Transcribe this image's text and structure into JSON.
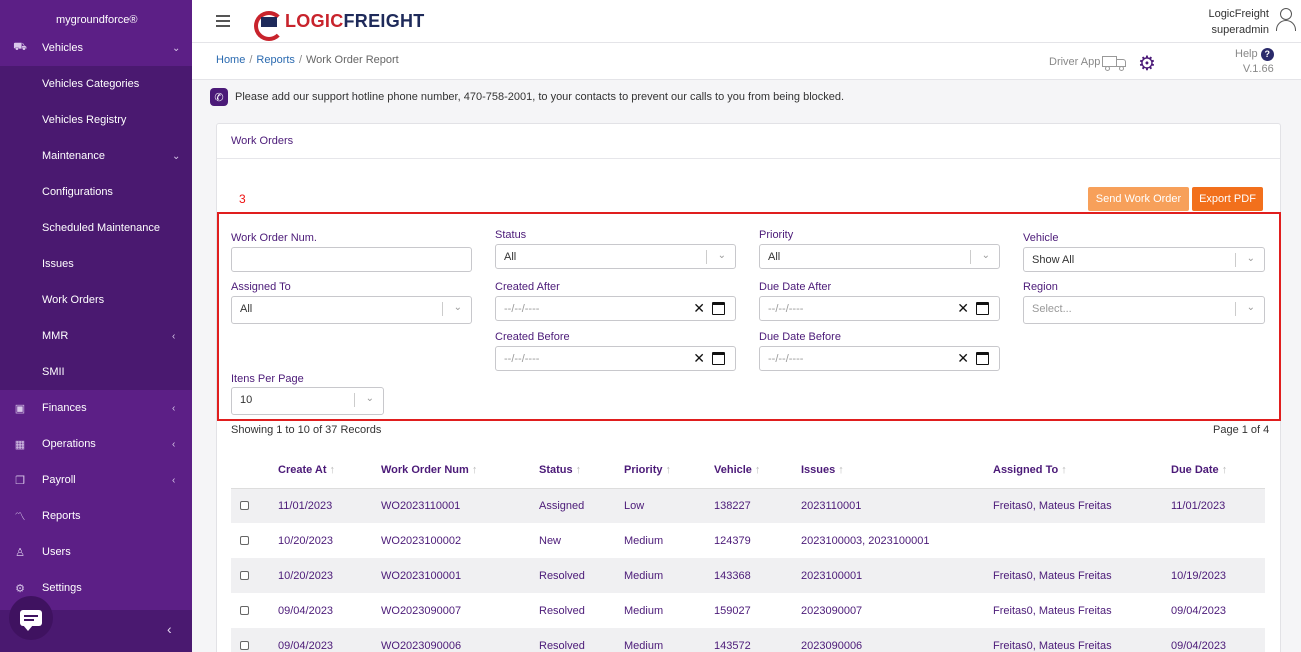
{
  "sidebar": {
    "brand": "mygroundforce®",
    "items": [
      {
        "label": "Vehicles",
        "icon": "truck-icon",
        "glyph": "⛟",
        "chev": "⌄"
      },
      {
        "label": "Vehicles Categories"
      },
      {
        "label": "Vehicles Registry"
      },
      {
        "label": "Maintenance",
        "chev": "⌄"
      },
      {
        "label": "Configurations"
      },
      {
        "label": "Scheduled Maintenance"
      },
      {
        "label": "Issues"
      },
      {
        "label": "Work Orders"
      },
      {
        "label": "MMR",
        "chev": "‹"
      },
      {
        "label": "SMII"
      },
      {
        "label": "Finances",
        "icon": "finances-icon",
        "glyph": "▣",
        "chev": "‹"
      },
      {
        "label": "Operations",
        "icon": "calendar-icon",
        "glyph": "▦",
        "chev": "‹"
      },
      {
        "label": "Payroll",
        "icon": "payroll-icon",
        "glyph": "❐",
        "chev": "‹"
      },
      {
        "label": "Reports",
        "icon": "chart-line-icon",
        "glyph": "〽"
      },
      {
        "label": "Users",
        "icon": "users-icon",
        "glyph": "♙"
      },
      {
        "label": "Settings",
        "icon": "settings-icon",
        "glyph": "⚙"
      }
    ],
    "collapse": "‹"
  },
  "topbar": {
    "logo_part1": "LOGIC",
    "logo_part2": "FREIGHT",
    "user_name": "LogicFreight",
    "user_role": "superadmin"
  },
  "breadcrumb": {
    "home": "Home",
    "reports": "Reports",
    "current": "Work Order Report",
    "sep": "/"
  },
  "header_tools": {
    "driver_app": "Driver App",
    "help": "Help",
    "help_q": "?",
    "version": "V.1.66"
  },
  "notice": {
    "text": "Please add our support hotline phone number, 470-758-2001, to your contacts to prevent our calls to you from being blocked."
  },
  "card": {
    "title": "Work Orders",
    "annotation": "3",
    "send_button": "Send Work Order",
    "export_button": "Export PDF"
  },
  "filters": {
    "work_order_num": {
      "label": "Work Order Num.",
      "value": ""
    },
    "status": {
      "label": "Status",
      "value": "All"
    },
    "priority": {
      "label": "Priority",
      "value": "All"
    },
    "vehicle": {
      "label": "Vehicle",
      "value": "Show All"
    },
    "assigned_to": {
      "label": "Assigned To",
      "value": "All"
    },
    "created_after": {
      "label": "Created After",
      "placeholder": "--/--/----"
    },
    "due_date_after": {
      "label": "Due Date After",
      "placeholder": "--/--/----"
    },
    "region": {
      "label": "Region",
      "placeholder": "Select..."
    },
    "created_before": {
      "label": "Created Before",
      "placeholder": "--/--/----"
    },
    "due_date_before": {
      "label": "Due Date Before",
      "placeholder": "--/--/----"
    },
    "items_per_page": {
      "label": "Itens Per Page",
      "value": "10"
    }
  },
  "table": {
    "records_text": "Showing 1 to 10 of 37 Records",
    "page_text": "Page 1 of 4",
    "columns": [
      "Create At",
      "Work Order Num",
      "Status",
      "Priority",
      "Vehicle",
      "Issues",
      "Assigned To",
      "Due Date"
    ],
    "rows": [
      {
        "create_at": "11/01/2023",
        "wo": "WO2023110001",
        "status": "Assigned",
        "priority": "Low",
        "vehicle": "138227",
        "issues": "2023110001",
        "assigned": "Freitas0, Mateus Freitas",
        "due": "11/01/2023"
      },
      {
        "create_at": "10/20/2023",
        "wo": "WO2023100002",
        "status": "New",
        "priority": "Medium",
        "vehicle": "124379",
        "issues": "2023100003, 2023100001",
        "assigned": "",
        "due": ""
      },
      {
        "create_at": "10/20/2023",
        "wo": "WO2023100001",
        "status": "Resolved",
        "priority": "Medium",
        "vehicle": "143368",
        "issues": "2023100001",
        "assigned": "Freitas0, Mateus Freitas",
        "due": "10/19/2023"
      },
      {
        "create_at": "09/04/2023",
        "wo": "WO2023090007",
        "status": "Resolved",
        "priority": "Medium",
        "vehicle": "159027",
        "issues": "2023090007",
        "assigned": "Freitas0, Mateus Freitas",
        "due": "09/04/2023"
      },
      {
        "create_at": "09/04/2023",
        "wo": "WO2023090006",
        "status": "Resolved",
        "priority": "Medium",
        "vehicle": "143572",
        "issues": "2023090006",
        "assigned": "Freitas0, Mateus Freitas",
        "due": "09/04/2023"
      }
    ]
  },
  "colors": {
    "sidebar": "#5c1f86",
    "sidebar_sub": "#4a1970",
    "accent": "#4b1a78",
    "orange": "#f2701c",
    "orange_light": "#f7a05a",
    "highlight_border": "#e01e1e"
  }
}
